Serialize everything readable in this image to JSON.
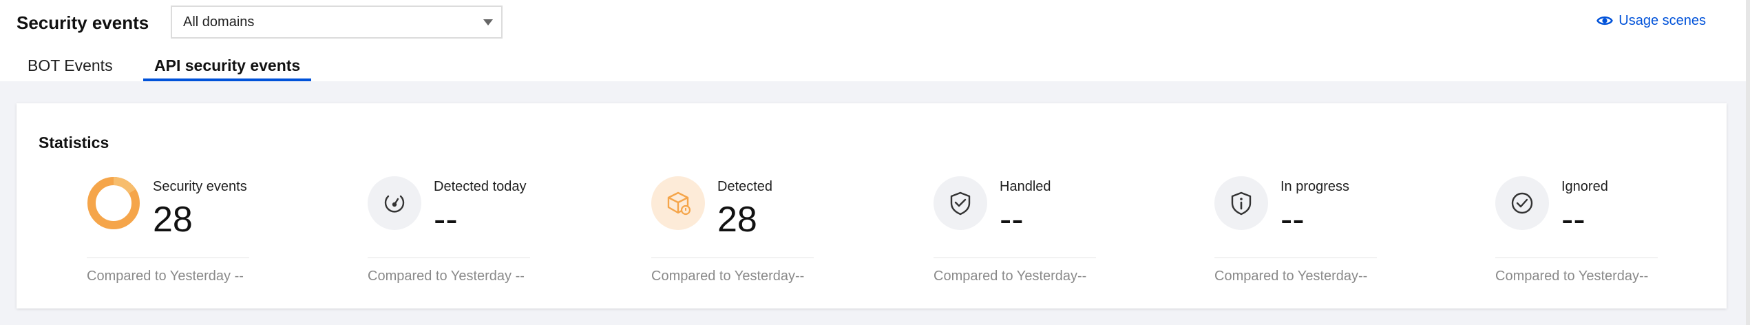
{
  "header": {
    "title": "Security events",
    "domain_select": {
      "selected": "All domains"
    },
    "usage_link": "Usage scenes"
  },
  "tabs": [
    {
      "label": "BOT Events",
      "active": false
    },
    {
      "label": "API security events",
      "active": true
    }
  ],
  "statistics": {
    "title": "Statistics",
    "items": [
      {
        "label": "Security events",
        "value": "28",
        "compare": "Compared to Yesterday --",
        "icon": "donut-chart-icon"
      },
      {
        "label": "Detected today",
        "value": "--",
        "compare": "Compared to Yesterday --",
        "icon": "gauge-icon"
      },
      {
        "label": "Detected",
        "value": "28",
        "compare": "Compared to Yesterday--",
        "icon": "box-alert-icon"
      },
      {
        "label": "Handled",
        "value": "--",
        "compare": "Compared to Yesterday--",
        "icon": "shield-check-icon"
      },
      {
        "label": "In progress",
        "value": "--",
        "compare": "Compared to Yesterday--",
        "icon": "shield-info-icon"
      },
      {
        "label": "Ignored",
        "value": "--",
        "compare": "Compared to Yesterday--",
        "icon": "check-circle-icon"
      }
    ]
  },
  "colors": {
    "accent": "#0052d9",
    "orange": "#f5a54a",
    "orange_bg": "#fdebd8"
  }
}
